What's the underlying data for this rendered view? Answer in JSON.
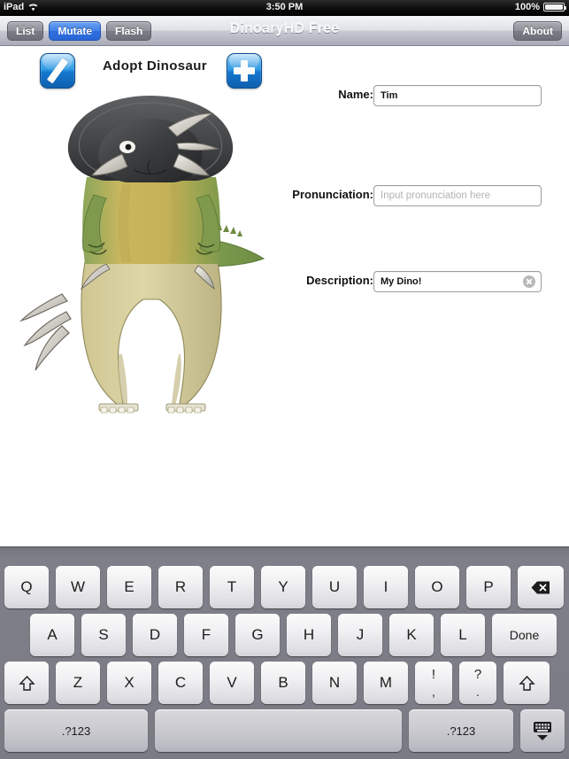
{
  "status_bar": {
    "device": "iPad",
    "wifi_icon": "wifi-icon",
    "time": "3:50 PM",
    "battery_percent": "100%",
    "battery_icon": "battery-full-icon"
  },
  "toolbar": {
    "title": "DinoaryHD Free",
    "segments": [
      {
        "label": "List",
        "selected": false
      },
      {
        "label": "Mutate",
        "selected": true
      },
      {
        "label": "Flash",
        "selected": false
      }
    ],
    "about_label": "About"
  },
  "main": {
    "section_title": "Adopt Dinosaur",
    "left_button_icon": "slash-icon",
    "right_button_icon": "plus-icon",
    "dinosaur_image": "dinosaur-composite-image",
    "form": {
      "name": {
        "label": "Name:",
        "value": "Tim",
        "placeholder": ""
      },
      "pronunciation": {
        "label": "Pronunciation:",
        "value": "",
        "placeholder": "Input pronunciation here"
      },
      "description": {
        "label": "Description:",
        "value": "My Dino!",
        "placeholder": "",
        "clear_icon": "clear-circle-x-icon"
      }
    }
  },
  "keyboard": {
    "row1": [
      "Q",
      "W",
      "E",
      "R",
      "T",
      "Y",
      "U",
      "I",
      "O",
      "P"
    ],
    "row1_backspace_icon": "backspace-icon",
    "row2": [
      "A",
      "S",
      "D",
      "F",
      "G",
      "H",
      "J",
      "K",
      "L"
    ],
    "row2_done": "Done",
    "row3_shift_icon": "shift-icon",
    "row3": [
      "Z",
      "X",
      "C",
      "V",
      "B",
      "N",
      "M"
    ],
    "row3_dual": [
      {
        "upper": "!",
        "lower": ","
      },
      {
        "upper": "?",
        "lower": "."
      }
    ],
    "row4_numeric_left": ".?123",
    "row4_space": "",
    "row4_numeric_right": ".?123",
    "row4_hide_icon": "hide-keyboard-icon"
  },
  "colors": {
    "accent_blue": "#3f7fe8",
    "button_grey": "#8e9099",
    "keyboard_bg": "#7a7b84",
    "key_face": "#f0f0f2",
    "icon_blue": "#2f9ae3",
    "placeholder_grey": "#b3b3b3"
  }
}
